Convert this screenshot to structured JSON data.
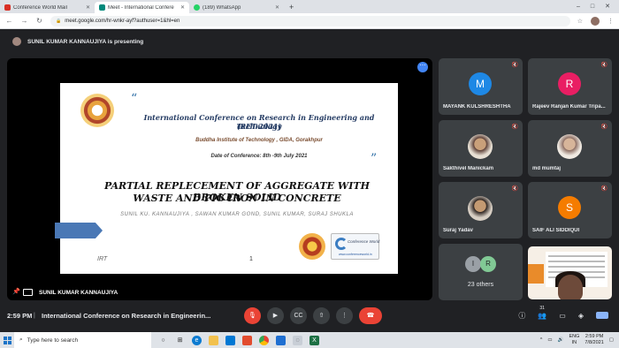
{
  "browser": {
    "tabs": [
      {
        "label": "Conference World Mail",
        "icon": "gmail-icon",
        "color": "#d93025",
        "active": false
      },
      {
        "label": "Meet - International Confere",
        "icon": "meet-icon",
        "color": "#00897b",
        "active": true
      },
      {
        "label": "(189) WhatsApp",
        "icon": "whatsapp-icon",
        "color": "#25d366",
        "active": false
      }
    ],
    "new_tab": "+",
    "window_controls": {
      "minimize": "–",
      "maximize": "□",
      "close": "✕"
    },
    "url": "meet.google.com/hr-wnkr-ayf?authuser=1&hl=en",
    "nav": {
      "back": "←",
      "forward": "→",
      "reload": "↻"
    }
  },
  "presenting": {
    "text": "SUNIL KUMAR KANNAUJIYA is presenting"
  },
  "slide": {
    "quote_open": "“",
    "quote_close": "”",
    "conf_title_1": "International Conference on Research in Engineering and Technology",
    "conf_title_2": "(RET-2021)",
    "institute": "Buddha Institute of Technology , GIDA, Gorakhpur",
    "date": "Date of Conference: 8th -9th July 2021",
    "paper_title_1": "PARTIAL REPLECEMENT OF AGGREGATE WITH  BROKEN SOLID",
    "paper_title_2": "WASTE AND PIG IRON IN CONCRETE",
    "authors": "SUNIL KU. KANNAUJIYA , SAWAN KUMAR GOND, SUNIL KUMAR, SURAJ SHUKLA",
    "logo_text": "Conference World",
    "logo_url": "www.conferenceworld.in",
    "footer_left": "IRT",
    "page_number": "1"
  },
  "stage": {
    "presenter_name": "SUNIL KUMAR KANNAUJIYA",
    "more": "⋯"
  },
  "participants": [
    {
      "name": "MAYANK KULSHRESHTHA",
      "initial": "M",
      "color": "#1e88e5",
      "type": "initial"
    },
    {
      "name": "Rajeev Ranjan Kumar Tripa...",
      "initial": "R",
      "color": "#e91e63",
      "type": "initial"
    },
    {
      "name": "Sakthivel Manickam",
      "initial": "",
      "color": "#5d4037",
      "type": "photo"
    },
    {
      "name": "md mumtaj",
      "initial": "",
      "color": "#8d6e63",
      "type": "photo"
    },
    {
      "name": "Suraj Yadav",
      "initial": "",
      "color": "#4e342e",
      "type": "photo"
    },
    {
      "name": "SAIF ALI SIDDIQUI",
      "initial": "S",
      "color": "#f57c00",
      "type": "initial"
    }
  ],
  "others": {
    "label": "23 others",
    "initials": [
      "I",
      "R"
    ],
    "colors": [
      "#9aa0a6",
      "#81c995"
    ]
  },
  "controls": {
    "time": "2:59 PM",
    "separator": "|",
    "meeting_title": "International Conference on Research in Engineerin...",
    "buttons": {
      "mic": "🎤",
      "cam": "◉",
      "cc": "CC",
      "present": "⇧",
      "more": "⋮",
      "end": "☎"
    },
    "info": "ⓘ",
    "people": "👥",
    "people_count": "31",
    "chat": "💬",
    "activities": "◈"
  },
  "taskbar": {
    "search_placeholder": "Type here to search",
    "language": "ENG",
    "region": "IN",
    "time": "2:59 PM",
    "date": "7/8/2021"
  }
}
